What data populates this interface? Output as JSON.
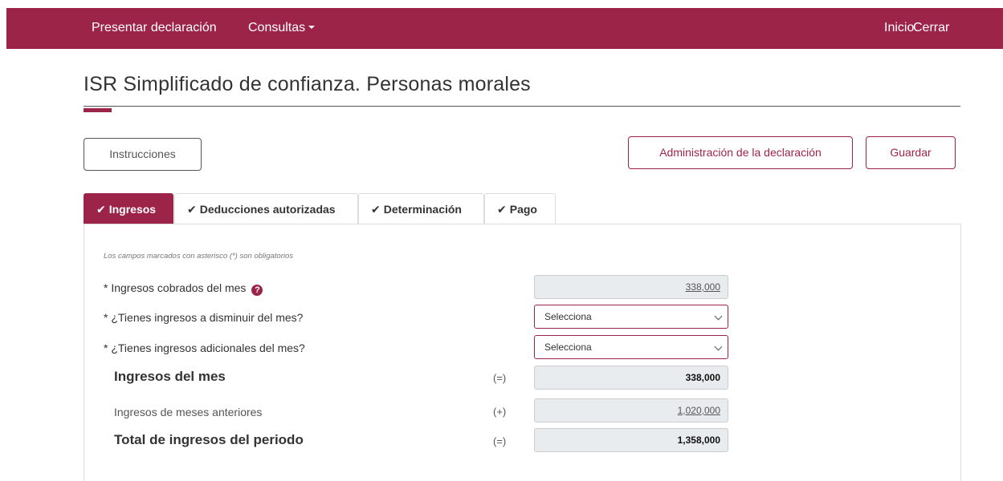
{
  "nav": {
    "present": "Presentar declaración",
    "consultas": "Consultas",
    "inicio": "Inicio",
    "cerrar": "Cerrar"
  },
  "page": {
    "title": "ISR Simplificado de confianza. Personas morales"
  },
  "buttons": {
    "instrucciones": "Instrucciones",
    "administracion": "Administración de la declaración",
    "guardar": "Guardar"
  },
  "tabs": [
    {
      "label": "Ingresos",
      "check": "✔",
      "active": true
    },
    {
      "label": "Deducciones autorizadas",
      "check": "✔",
      "active": false
    },
    {
      "label": "Determinación",
      "check": "✔",
      "active": false
    },
    {
      "label": "Pago",
      "check": "✔",
      "active": false
    }
  ],
  "form": {
    "note": "Los campos marcados con asterisco (*) son obligatorios",
    "ingresos_cobrados": {
      "label": "* Ingresos cobrados del mes",
      "value": "338,000",
      "help": "?"
    },
    "ingresos_disminuir": {
      "label": "* ¿Tienes ingresos a disminuir del mes?",
      "value": "Selecciona"
    },
    "ingresos_adicionales": {
      "label": "* ¿Tienes ingresos adicionales del mes?",
      "value": "Selecciona"
    },
    "ingresos_mes": {
      "label": "Ingresos del mes",
      "op": "(=)",
      "value": "338,000"
    },
    "meses_anteriores": {
      "label": "Ingresos de meses anteriores",
      "op": "(+)",
      "value": "1,020,000"
    },
    "total_periodo": {
      "label": "Total de ingresos del periodo",
      "op": "(=)",
      "value": "1,358,000"
    }
  },
  "colors": {
    "brand": "#9d2449",
    "field_bg": "#e9ecef"
  }
}
